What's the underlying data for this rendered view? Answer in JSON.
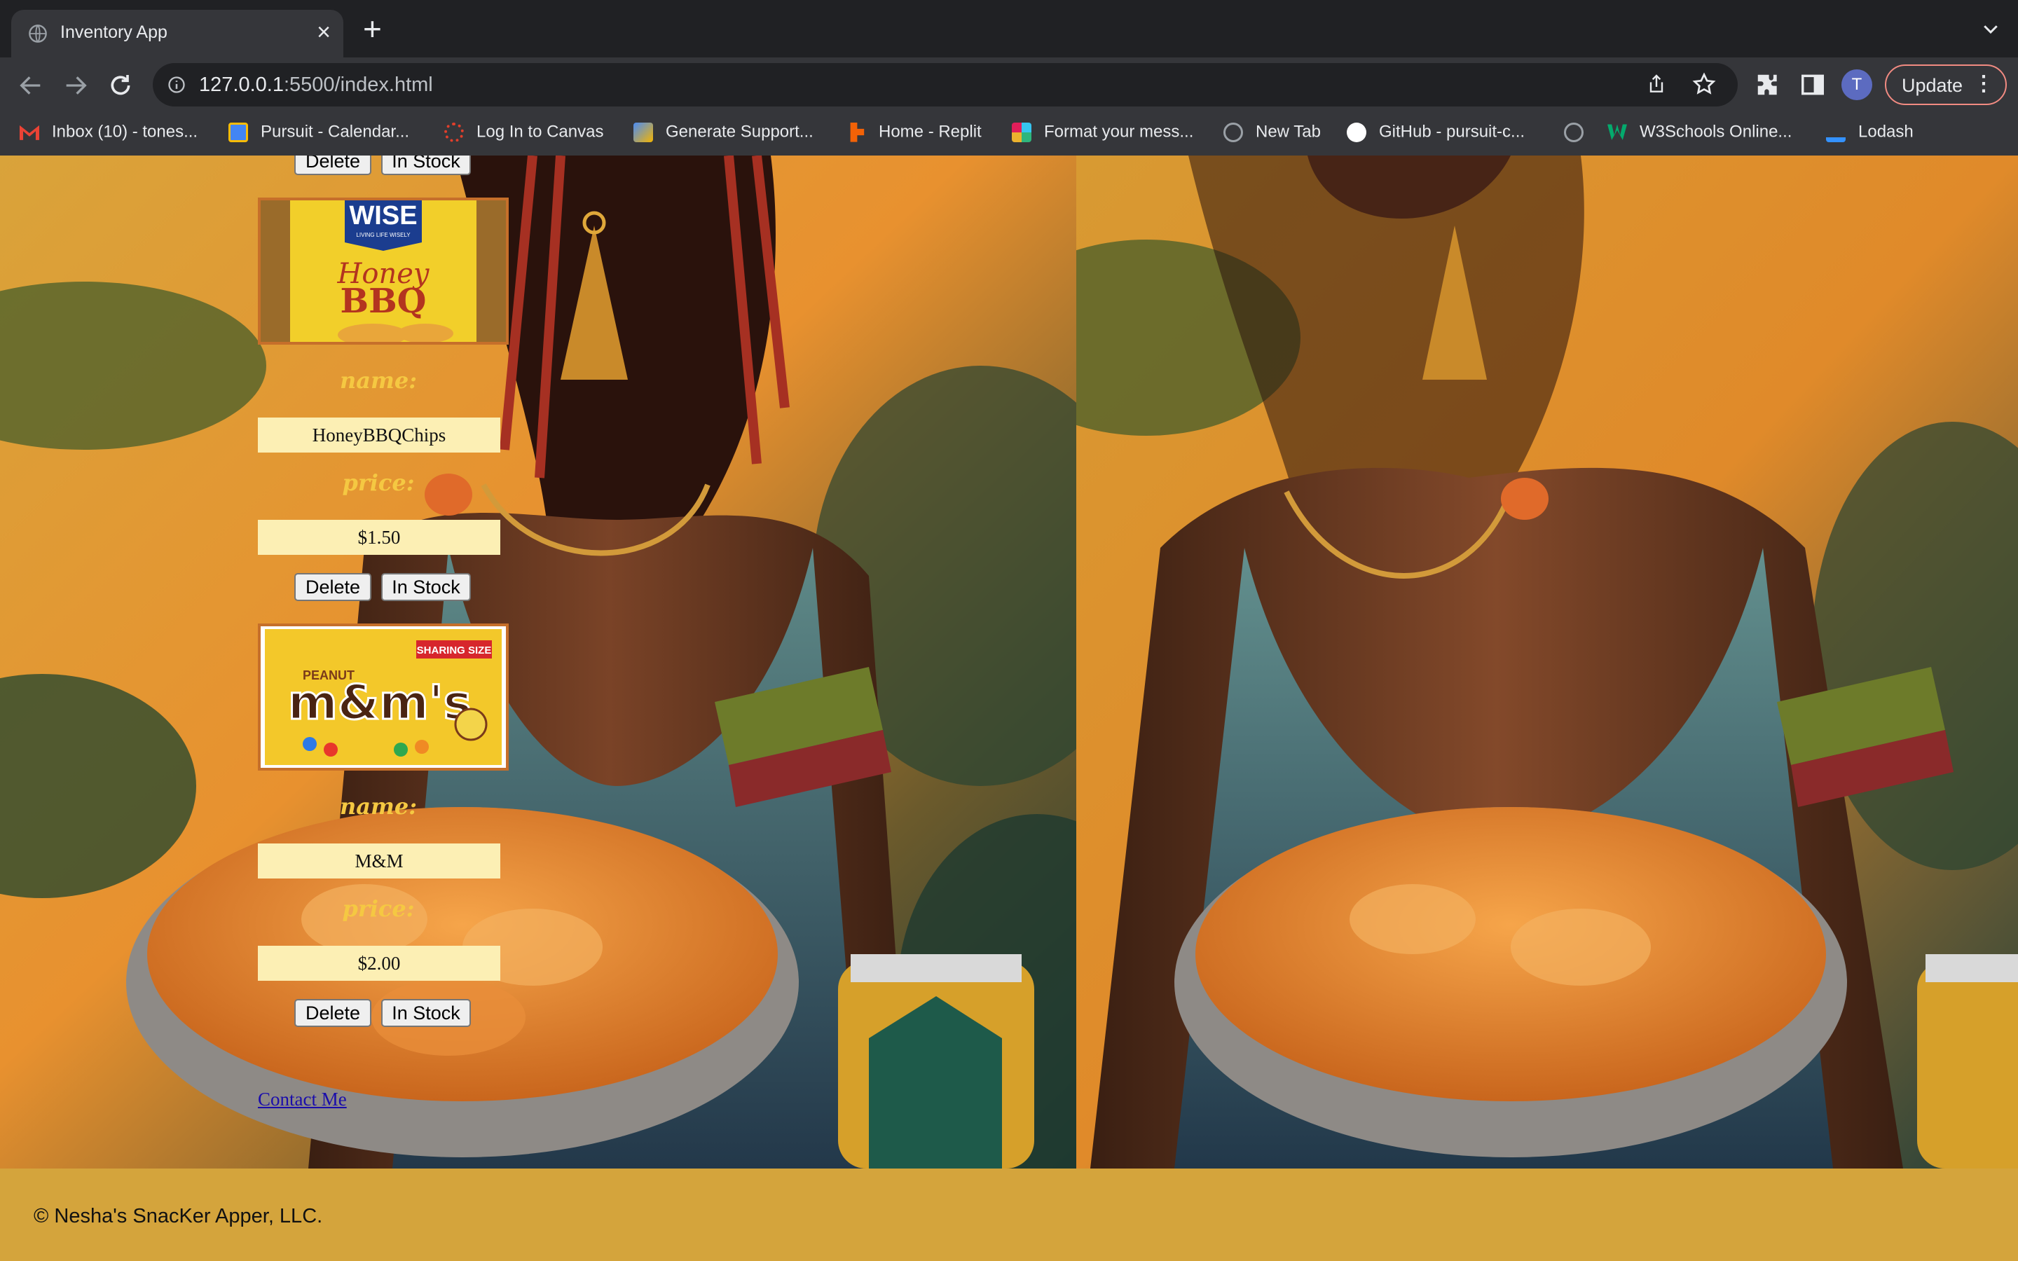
{
  "browser": {
    "tab_title": "Inventory App",
    "url_host": "127.0.0.1",
    "url_rest": ":5500/index.html",
    "update_label": "Update",
    "avatar_letter": "T",
    "bookmarks": [
      {
        "label": "Inbox (10) - tones...",
        "icon": "gmail-icon",
        "color": "#ea4335"
      },
      {
        "label": "Pursuit - Calendar...",
        "icon": "calendar-icon",
        "color": "#4285f4"
      },
      {
        "label": "Log In to Canvas",
        "icon": "canvas-icon",
        "color": "#e13f2b"
      },
      {
        "label": "Generate Support...",
        "icon": "generate-icon",
        "color": "#4a8cf7"
      },
      {
        "label": "Home - Replit",
        "icon": "replit-icon",
        "color": "#f26207"
      },
      {
        "label": "Format your mess...",
        "icon": "slack-icon",
        "color": "#36c5f0"
      },
      {
        "label": "New Tab",
        "icon": "globe-icon",
        "color": "#9aa0a6"
      },
      {
        "label": "GitHub - pursuit-c...",
        "icon": "github-icon",
        "color": "#ffffff"
      },
      {
        "label": "",
        "icon": "globe-icon",
        "color": "#9aa0a6"
      },
      {
        "label": "W3Schools Online...",
        "icon": "w3schools-icon",
        "color": "#04aa6d"
      },
      {
        "label": "Lodash",
        "icon": "lodash-icon",
        "color": "#3492ff"
      }
    ]
  },
  "page": {
    "delete_label": "Delete",
    "in_stock_label": "In Stock",
    "name_label": "name:",
    "price_label": "price:",
    "products": [
      {
        "name": "HoneyBBQChips",
        "price": "$1.50",
        "brand": "WISE",
        "brand_sub": "LIVING LIFE WISELY",
        "flavor_top": "Honey",
        "flavor_bottom": "BBQ"
      },
      {
        "name": "M&M",
        "price": "$2.00",
        "brand": "m&m's",
        "brand_sub": "PEANUT",
        "badge": "SHARING SIZE"
      }
    ],
    "contact_label": "Contact Me",
    "footer_text": "© Nesha's SnacKer Apper, LLC."
  },
  "colors": {
    "accent_label": "#f5c842",
    "field_bg": "#fcefb4",
    "footer_bg": "#d4a43c",
    "image_border": "#c66f2a"
  }
}
